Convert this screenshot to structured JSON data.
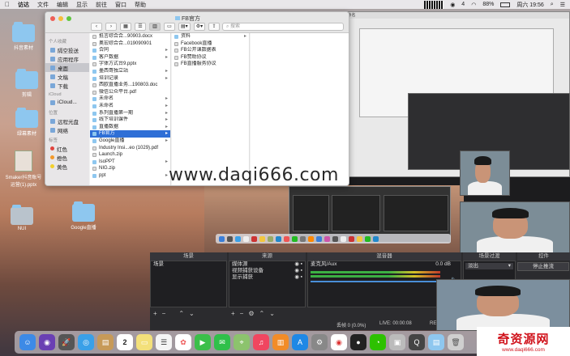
{
  "menubar": {
    "app": "访达",
    "items": [
      "文件",
      "编辑",
      "显示",
      "前往",
      "窗口",
      "帮助"
    ],
    "battery": "88%",
    "clock": "周六 19:56",
    "notif_count": "4"
  },
  "desktop_icons": [
    {
      "label": "抖音素材"
    },
    {
      "label": "剪辑"
    },
    {
      "label": "绿幕素材"
    },
    {
      "label": "Smaker抖音账号\n运营(1).pptx"
    },
    {
      "label": "NUI"
    },
    {
      "label": "Google直播"
    }
  ],
  "finder": {
    "title": "FB官方",
    "search_placeholder": "搜索",
    "sidebar": {
      "head_personal": "个人收藏",
      "items": [
        {
          "label": "隔空投送"
        },
        {
          "label": "应用程序"
        },
        {
          "label": "桌面"
        },
        {
          "label": "文稿"
        },
        {
          "label": "下载"
        }
      ],
      "head_icloud": "iCloud",
      "icloud_items": [
        {
          "label": "iCloud..."
        }
      ],
      "head_location": "位置",
      "location_items": [
        {
          "label": "远程光盘"
        },
        {
          "label": "网络"
        }
      ],
      "head_tags": "标签",
      "tag_items": [
        {
          "label": "红色",
          "color": "#e0443e"
        },
        {
          "label": "橙色",
          "color": "#f39a2b"
        },
        {
          "label": "黄色",
          "color": "#f3d02b"
        }
      ]
    },
    "col1": [
      {
        "label": "抵言综合合...90903.docx",
        "type": "file"
      },
      {
        "label": "奥宏综合合...019090901",
        "type": "file"
      },
      {
        "label": "合同",
        "type": "folder",
        "arrow": true
      },
      {
        "label": "客户数据",
        "type": "folder",
        "arrow": true
      },
      {
        "label": "字体方式台9.pptx",
        "type": "file"
      },
      {
        "label": "墨西哥独立站",
        "type": "folder",
        "arrow": true
      },
      {
        "label": "培训记录",
        "type": "folder",
        "arrow": true
      },
      {
        "label": "西欧直播业务...190803.doc",
        "type": "file"
      },
      {
        "label": "微信公众平台.pdf",
        "type": "file"
      },
      {
        "label": "未命名",
        "type": "folder",
        "arrow": true
      },
      {
        "label": "未命名",
        "type": "folder",
        "arrow": true
      },
      {
        "label": "系列直播第一期",
        "type": "folder",
        "arrow": true
      },
      {
        "label": "线下培训课件",
        "type": "folder",
        "arrow": true
      },
      {
        "label": "直播数据",
        "type": "folder",
        "arrow": true
      },
      {
        "label": "FB官方",
        "type": "folder",
        "arrow": true,
        "selected": true
      },
      {
        "label": "Google直播",
        "type": "folder",
        "arrow": true
      },
      {
        "label": "Industry Insi...eo (1029).pdf",
        "type": "file"
      },
      {
        "label": "Launch.zip",
        "type": "file"
      },
      {
        "label": "IsoPPT",
        "type": "folder",
        "arrow": true
      },
      {
        "label": "NIG.zip",
        "type": "file"
      },
      {
        "label": "ppt",
        "type": "folder",
        "arrow": true
      }
    ],
    "col2": [
      {
        "label": "资料",
        "type": "folder",
        "arrow": true
      },
      {
        "label": "Facebook直播",
        "type": "file"
      },
      {
        "label": "FB公开课数据表",
        "type": "file"
      },
      {
        "label": "FB赞助协议",
        "type": "file"
      },
      {
        "label": "FB直播服务协议",
        "type": "file"
      }
    ]
  },
  "watermark": "www.daqi666.com",
  "obs": {
    "scenes_title": "场景",
    "sources_title": "来源",
    "mixer_title": "混音器",
    "transitions_title": "场景过渡",
    "controls_title": "控件",
    "scene_items": [
      "场景"
    ],
    "source_items": [
      "媒体源",
      "视频捕获设备",
      "显示捕获"
    ],
    "mixer_label": "麦克风/Aux",
    "mixer_db": "0.0 dB",
    "transition_value": "淡出",
    "stop_stream": "停止推流",
    "status_dropped": "丢帧 0 (0.0%)",
    "status_live": "LIVE: 00:00:08",
    "status_rec": "REC"
  },
  "preview_header": "推流 - 未命名",
  "dock_date": "2",
  "logo": {
    "title": "奇资源网",
    "url": "www.daqi666.com"
  }
}
